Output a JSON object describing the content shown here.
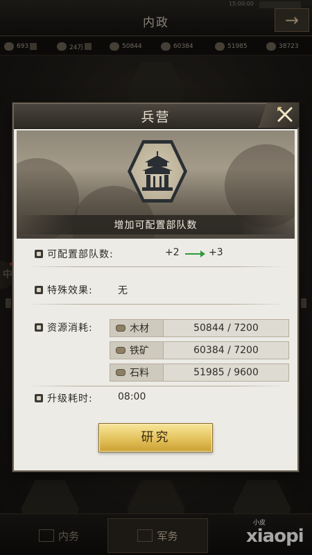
{
  "status": {
    "time": "15:00:00"
  },
  "screen": {
    "title": "内政",
    "back_arrow": "→"
  },
  "resources": [
    {
      "value": "693",
      "icon": "copper-coin-icon"
    },
    {
      "value": "24万",
      "icon": "coin-icon"
    },
    {
      "value": "50844",
      "icon": "wood-icon"
    },
    {
      "value": "60384",
      "icon": "iron-icon"
    },
    {
      "value": "51985",
      "icon": "stone-icon"
    },
    {
      "value": "38723",
      "icon": "grain-icon"
    }
  ],
  "modal": {
    "title": "兵营",
    "caption": "增加可配置部队数",
    "rows": {
      "troops": {
        "label": "可配置部队数:",
        "from": "+2",
        "to": "+3"
      },
      "effect": {
        "label": "特殊效果:",
        "value": "无"
      },
      "cost": {
        "label": "资源消耗:",
        "items": [
          {
            "name": "木材",
            "amount": "50844 / 7200",
            "icon": "wood-icon"
          },
          {
            "name": "铁矿",
            "amount": "60384 / 7200",
            "icon": "iron-ore-icon"
          },
          {
            "name": "石料",
            "amount": "51985 / 9600",
            "icon": "stone-icon"
          }
        ]
      },
      "time": {
        "label": "升级耗时:",
        "value": "08:00"
      }
    },
    "button": "研究"
  },
  "bottom_nav": [
    {
      "label": "内务",
      "active": false
    },
    {
      "label": "军务",
      "active": true
    }
  ],
  "side_tab_glyph": "中",
  "watermark": {
    "small": "小皮",
    "big": "xiaopi"
  },
  "colors": {
    "accent_button": "#e4c25c",
    "arrow_green": "#2f9a3c",
    "panel": "#ecebe6"
  }
}
